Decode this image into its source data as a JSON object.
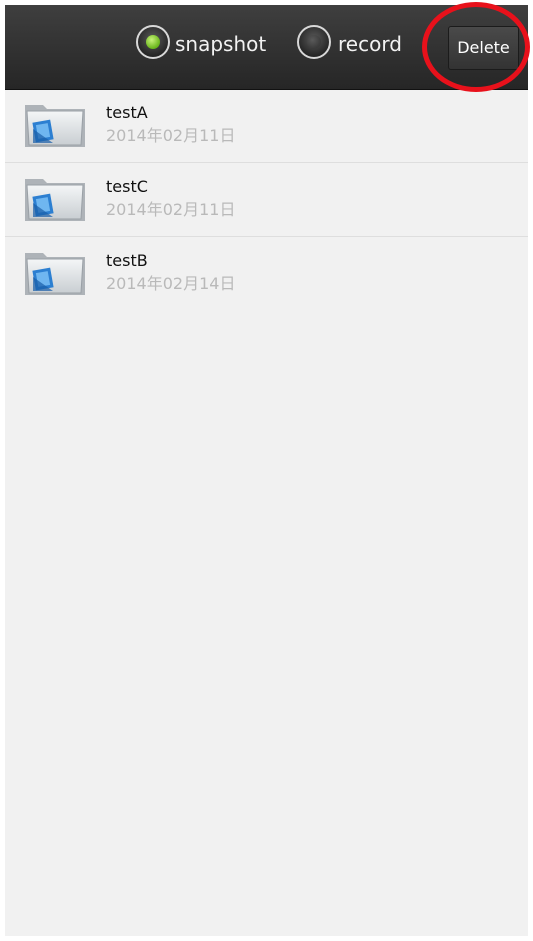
{
  "toolbar": {
    "mode_options": [
      {
        "label": "snapshot",
        "selected": true
      },
      {
        "label": "record",
        "selected": false
      }
    ],
    "delete_label": "Delete",
    "selected_indicator_color": "#7cc52a"
  },
  "annotation": {
    "shape": "circle",
    "color": "#e8111b",
    "target": "delete-button"
  },
  "list": {
    "items": [
      {
        "name": "testA",
        "date": "2014年02月11日",
        "icon": "folder-video-icon"
      },
      {
        "name": "testC",
        "date": "2014年02月11日",
        "icon": "folder-video-icon"
      },
      {
        "name": "testB",
        "date": "2014年02月14日",
        "icon": "folder-video-icon"
      }
    ]
  }
}
